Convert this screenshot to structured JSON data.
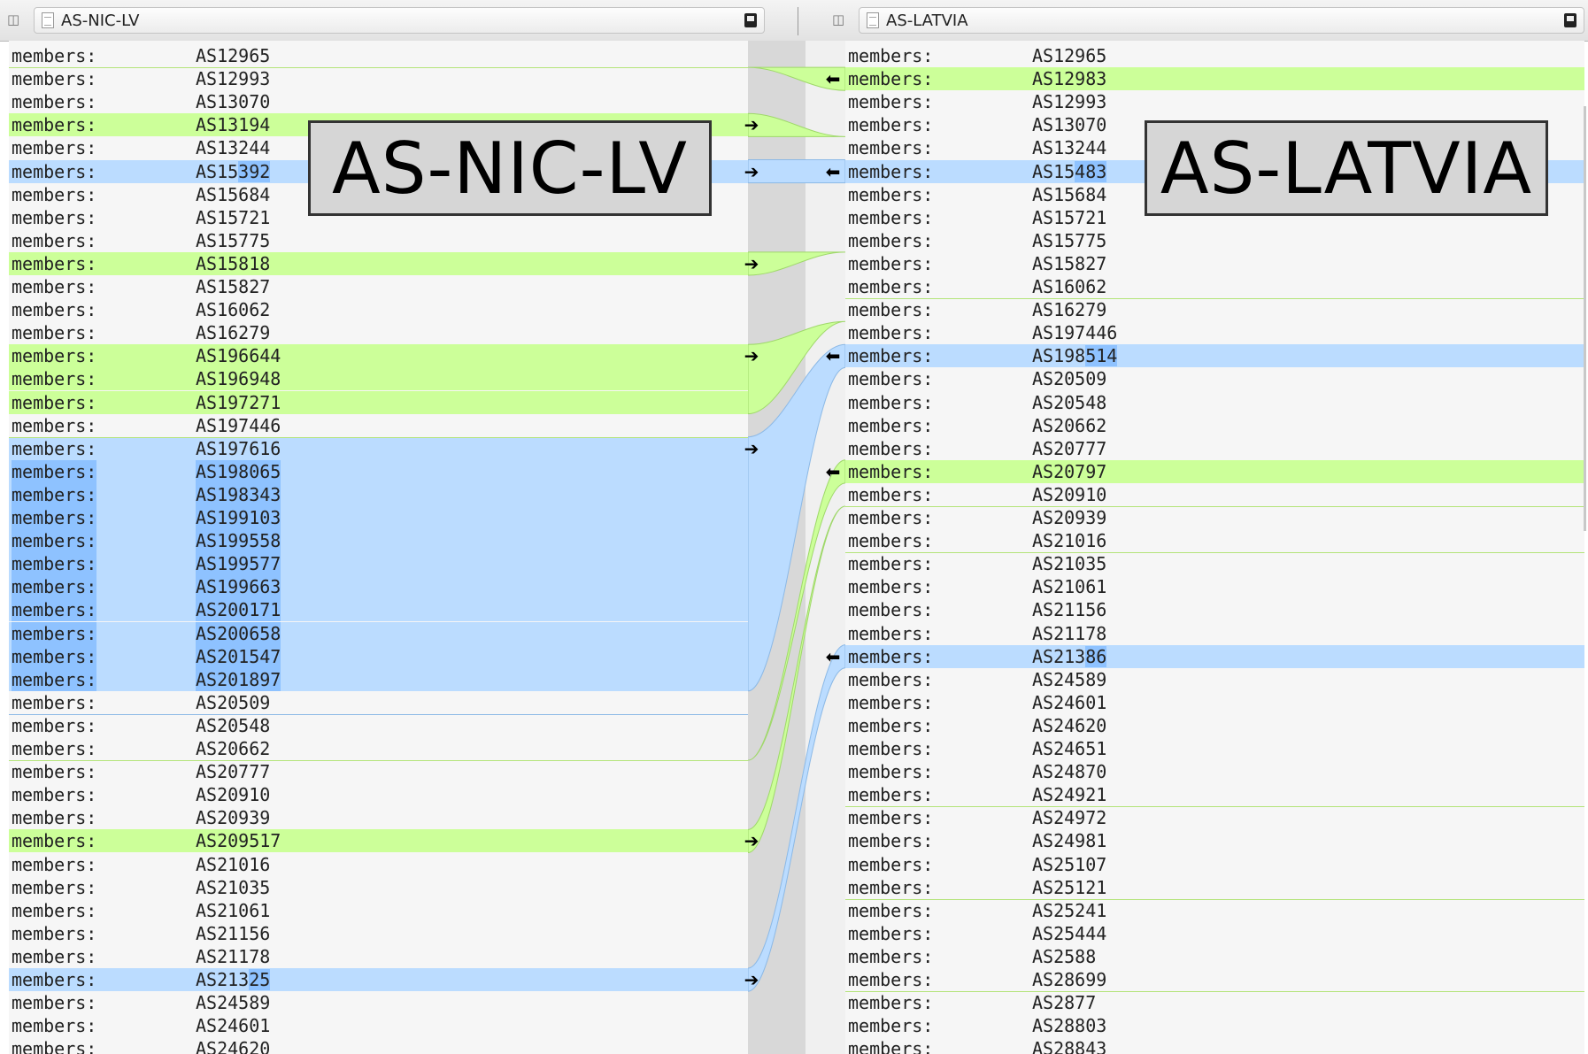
{
  "left_pane": {
    "title": "AS-NIC-LV",
    "label": "AS-NIC-LV",
    "rows": [
      {
        "key": "members:",
        "value": "AS12965",
        "state": ""
      },
      {
        "key": "members:",
        "value": "AS12993",
        "state": ""
      },
      {
        "key": "members:",
        "value": "AS13070",
        "state": ""
      },
      {
        "key": "members:",
        "value": "AS13194",
        "state": "green",
        "arrow": true
      },
      {
        "key": "members:",
        "value": "AS13244",
        "state": ""
      },
      {
        "key": "members:",
        "value": "AS15392",
        "state": "blue",
        "arrow": true,
        "hl_from": 4
      },
      {
        "key": "members:",
        "value": "AS15684",
        "state": ""
      },
      {
        "key": "members:",
        "value": "AS15721",
        "state": ""
      },
      {
        "key": "members:",
        "value": "AS15775",
        "state": ""
      },
      {
        "key": "members:",
        "value": "AS15818",
        "state": "green",
        "arrow": true
      },
      {
        "key": "members:",
        "value": "AS15827",
        "state": ""
      },
      {
        "key": "members:",
        "value": "AS16062",
        "state": ""
      },
      {
        "key": "members:",
        "value": "AS16279",
        "state": ""
      },
      {
        "key": "members:",
        "value": "AS196644",
        "state": "green",
        "arrow": true
      },
      {
        "key": "members:",
        "value": "AS196948",
        "state": "green"
      },
      {
        "key": "members:",
        "value": "AS197271",
        "state": "green"
      },
      {
        "key": "members:",
        "value": "AS197446",
        "state": ""
      },
      {
        "key": "members:",
        "value": "AS197616",
        "state": "blue",
        "arrow": true
      },
      {
        "key": "members:",
        "value": "AS198065",
        "state": "blue-dark"
      },
      {
        "key": "members:",
        "value": "AS198343",
        "state": "blue-dark"
      },
      {
        "key": "members:",
        "value": "AS199103",
        "state": "blue-dark"
      },
      {
        "key": "members:",
        "value": "AS199558",
        "state": "blue-dark"
      },
      {
        "key": "members:",
        "value": "AS199577",
        "state": "blue-dark"
      },
      {
        "key": "members:",
        "value": "AS199663",
        "state": "blue-dark"
      },
      {
        "key": "members:",
        "value": "AS200171",
        "state": "blue-dark"
      },
      {
        "key": "members:",
        "value": "AS200658",
        "state": "blue-dark"
      },
      {
        "key": "members:",
        "value": "AS201547",
        "state": "blue-dark"
      },
      {
        "key": "members:",
        "value": "AS201897",
        "state": "blue-dark"
      },
      {
        "key": "members:",
        "value": "AS20509",
        "state": ""
      },
      {
        "key": "members:",
        "value": "AS20548",
        "state": ""
      },
      {
        "key": "members:",
        "value": "AS20662",
        "state": ""
      },
      {
        "key": "members:",
        "value": "AS20777",
        "state": ""
      },
      {
        "key": "members:",
        "value": "AS20910",
        "state": ""
      },
      {
        "key": "members:",
        "value": "AS20939",
        "state": ""
      },
      {
        "key": "members:",
        "value": "AS209517",
        "state": "green",
        "arrow": true
      },
      {
        "key": "members:",
        "value": "AS21016",
        "state": ""
      },
      {
        "key": "members:",
        "value": "AS21035",
        "state": ""
      },
      {
        "key": "members:",
        "value": "AS21061",
        "state": ""
      },
      {
        "key": "members:",
        "value": "AS21156",
        "state": ""
      },
      {
        "key": "members:",
        "value": "AS21178",
        "state": ""
      },
      {
        "key": "members:",
        "value": "AS21325",
        "state": "blue",
        "arrow": true,
        "hl_from": 5
      },
      {
        "key": "members:",
        "value": "AS24589",
        "state": ""
      },
      {
        "key": "members:",
        "value": "AS24601",
        "state": ""
      },
      {
        "key": "members:",
        "value": "AS24620",
        "state": ""
      }
    ]
  },
  "right_pane": {
    "title": "AS-LATVIA",
    "label": "AS-LATVIA",
    "rows": [
      {
        "key": "members:",
        "value": "AS12965",
        "state": ""
      },
      {
        "key": "members:",
        "value": "AS12983",
        "state": "green",
        "arrow": true
      },
      {
        "key": "members:",
        "value": "AS12993",
        "state": ""
      },
      {
        "key": "members:",
        "value": "AS13070",
        "state": ""
      },
      {
        "key": "members:",
        "value": "AS13244",
        "state": ""
      },
      {
        "key": "members:",
        "value": "AS15483",
        "state": "blue",
        "arrow": true,
        "hl_from": 4
      },
      {
        "key": "members:",
        "value": "AS15684",
        "state": ""
      },
      {
        "key": "members:",
        "value": "AS15721",
        "state": ""
      },
      {
        "key": "members:",
        "value": "AS15775",
        "state": ""
      },
      {
        "key": "members:",
        "value": "AS15827",
        "state": ""
      },
      {
        "key": "members:",
        "value": "AS16062",
        "state": ""
      },
      {
        "key": "members:",
        "value": "AS16279",
        "state": ""
      },
      {
        "key": "members:",
        "value": "AS197446",
        "state": ""
      },
      {
        "key": "members:",
        "value": "AS198514",
        "state": "blue",
        "arrow": true,
        "hl_from": 5
      },
      {
        "key": "members:",
        "value": "AS20509",
        "state": ""
      },
      {
        "key": "members:",
        "value": "AS20548",
        "state": ""
      },
      {
        "key": "members:",
        "value": "AS20662",
        "state": ""
      },
      {
        "key": "members:",
        "value": "AS20777",
        "state": ""
      },
      {
        "key": "members:",
        "value": "AS20797",
        "state": "green",
        "arrow": true
      },
      {
        "key": "members:",
        "value": "AS20910",
        "state": ""
      },
      {
        "key": "members:",
        "value": "AS20939",
        "state": ""
      },
      {
        "key": "members:",
        "value": "AS21016",
        "state": ""
      },
      {
        "key": "members:",
        "value": "AS21035",
        "state": ""
      },
      {
        "key": "members:",
        "value": "AS21061",
        "state": ""
      },
      {
        "key": "members:",
        "value": "AS21156",
        "state": ""
      },
      {
        "key": "members:",
        "value": "AS21178",
        "state": ""
      },
      {
        "key": "members:",
        "value": "AS21386",
        "state": "blue",
        "arrow": true,
        "hl_from": 5
      },
      {
        "key": "members:",
        "value": "AS24589",
        "state": ""
      },
      {
        "key": "members:",
        "value": "AS24601",
        "state": ""
      },
      {
        "key": "members:",
        "value": "AS24620",
        "state": ""
      },
      {
        "key": "members:",
        "value": "AS24651",
        "state": ""
      },
      {
        "key": "members:",
        "value": "AS24870",
        "state": ""
      },
      {
        "key": "members:",
        "value": "AS24921",
        "state": ""
      },
      {
        "key": "members:",
        "value": "AS24972",
        "state": ""
      },
      {
        "key": "members:",
        "value": "AS24981",
        "state": ""
      },
      {
        "key": "members:",
        "value": "AS25107",
        "state": ""
      },
      {
        "key": "members:",
        "value": "AS25121",
        "state": ""
      },
      {
        "key": "members:",
        "value": "AS25241",
        "state": ""
      },
      {
        "key": "members:",
        "value": "AS25444",
        "state": ""
      },
      {
        "key": "members:",
        "value": "AS2588",
        "state": ""
      },
      {
        "key": "members:",
        "value": "AS28699",
        "state": ""
      },
      {
        "key": "members:",
        "value": "AS2877",
        "state": ""
      },
      {
        "key": "members:",
        "value": "AS28803",
        "state": ""
      },
      {
        "key": "members:",
        "value": "AS28843",
        "state": ""
      }
    ]
  },
  "icons": {
    "left_pane_icon": "split-pane-icon",
    "doc_icon": "document-icon",
    "save_icon": "save-icon",
    "arrow_right": "copy-right-arrow-icon",
    "arrow_left": "copy-left-arrow-icon"
  },
  "colors": {
    "insert_green": "#ccff99",
    "change_blue": "#bbdcff",
    "change_blue_dark": "#8ec2ff",
    "gutter_gray": "#d8d8d8"
  }
}
